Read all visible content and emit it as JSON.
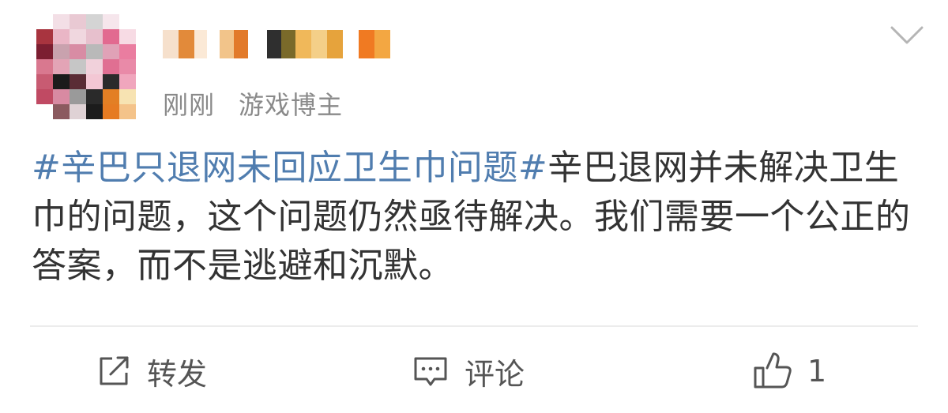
{
  "post": {
    "time": "刚刚",
    "author_tag": "游戏博主",
    "topic": "#辛巴只退网未回应卫生巾问题#",
    "body": "辛巴退网并未解决卫生巾的问题，这个问题仍然亟待解决。我们需要一个公正的答案，而不是逃避和沉默。"
  },
  "actions": {
    "repost_label": "转发",
    "comment_label": "评论",
    "like_count": "1"
  },
  "colors": {
    "topic": "#507daf",
    "text": "#333333",
    "meta": "#8a8a8a"
  }
}
